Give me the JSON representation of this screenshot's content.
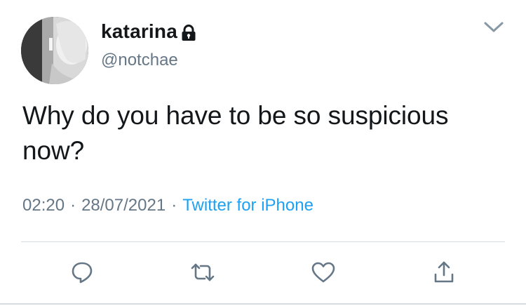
{
  "tweet": {
    "display_name": "katarina",
    "handle": "@notchae",
    "text": "Why do you have to be so suspicious now?",
    "time": "02:20",
    "date": "28/07/2021",
    "separator": "·",
    "source": "Twitter for iPhone"
  },
  "icons": {
    "lock": "lock-icon",
    "more": "chevron-down-icon",
    "reply": "reply-icon",
    "retweet": "retweet-icon",
    "like": "heart-icon",
    "share": "share-icon"
  },
  "colors": {
    "text": "#14171a",
    "secondary": "#657786",
    "link": "#1da1f2",
    "icon": "#657786",
    "divider": "#d7dce0"
  }
}
